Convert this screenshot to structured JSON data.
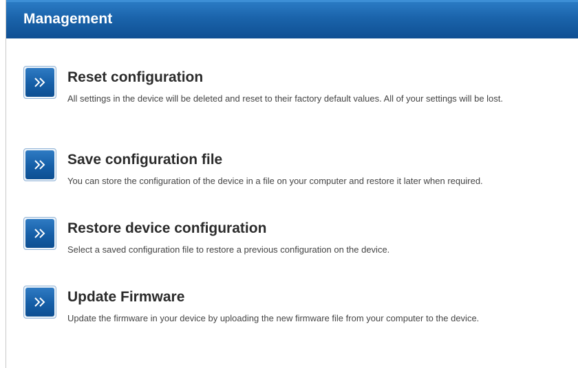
{
  "header": {
    "title": "Management"
  },
  "items": [
    {
      "title": "Reset configuration",
      "description": "All settings in the device will be deleted and reset to their factory default values. All of your settings will be lost.",
      "icon": "double-chevron-right-icon"
    },
    {
      "title": "Save configuration file",
      "description": "You can store the configuration of the device in a file on your computer and restore it later when required.",
      "icon": "double-chevron-right-icon"
    },
    {
      "title": "Restore device configuration",
      "description": "Select a saved configuration file to restore a previous configuration on the device.",
      "icon": "double-chevron-right-icon"
    },
    {
      "title": "Update Firmware",
      "description": "Update the firmware in your device by uploading the new firmware file from your computer to the device.",
      "icon": "double-chevron-right-icon"
    }
  ],
  "colors": {
    "header_bg": "#1a63aa",
    "button_bg": "#155ea7",
    "title_text": "#2b2b2b",
    "desc_text": "#444444"
  }
}
